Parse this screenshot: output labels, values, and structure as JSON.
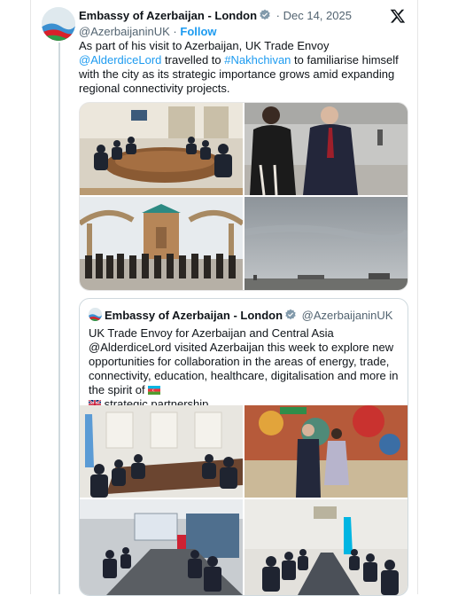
{
  "tweet": {
    "author_name": "Embassy of Azerbaijan - London",
    "date": "Dec 14, 2025",
    "handle": "@AzerbaijaninUK",
    "follow_label": "Follow",
    "text_1": "As part of his visit to Azerbaijan, UK Trade Envoy ",
    "mention": "@AlderdiceLord",
    "text_2": " travelled to ",
    "hashtag": "#Nakhchivan",
    "text_3": " to familiarise himself with the city as its strategic importance grows amid expanding regional connectivity projects."
  },
  "quoted_tweet": {
    "author_name": "Embassy of Azerbaijan - London",
    "handle": "@AzerbaijaninUK",
    "text_1": "UK Trade Envoy for Azerbaijan and Central Asia @AlderdiceLord visited Azerbaijan this week to explore new opportunities for collaboration in the areas of energy, trade, connectivity, education, healthcare, digitalisation and more in the spirit of ",
    "text_2": " strategic partnership"
  },
  "icons": {
    "platform_logo": "x-logo-icon",
    "verified": "verified-badge-icon",
    "flag_az": "azerbaijan-flag-icon",
    "flag_uk": "uk-flag-icon"
  },
  "colors": {
    "link": "#1d9bf0",
    "muted": "#536471",
    "verified": "#829aab"
  }
}
